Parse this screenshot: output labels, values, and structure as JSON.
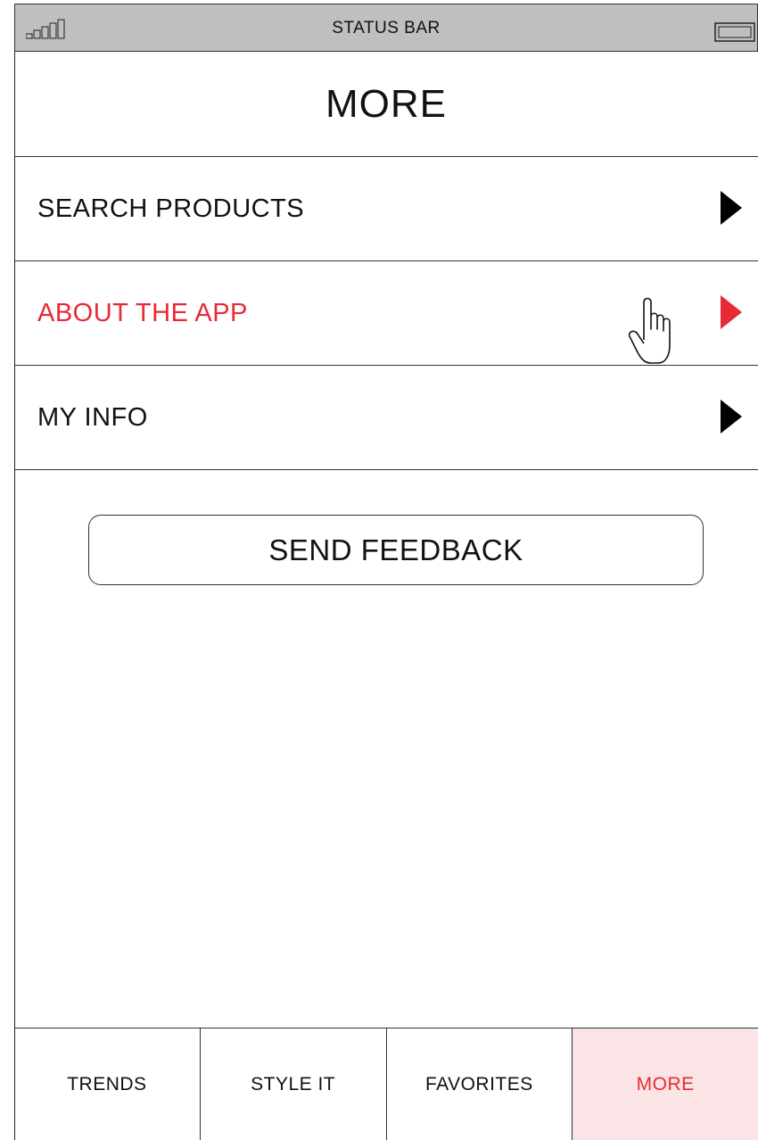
{
  "status_bar": {
    "title": "STATUS BAR",
    "signal_icon": "signal-strength-icon",
    "battery_icon": "battery-icon"
  },
  "header": {
    "title": "MORE"
  },
  "menu": {
    "items": [
      {
        "label": "SEARCH PRODUCTS",
        "icon": "chevron-right-icon",
        "active": false
      },
      {
        "label": "ABOUT THE APP",
        "icon": "chevron-right-icon",
        "active": true
      },
      {
        "label": "MY INFO",
        "icon": "chevron-right-icon",
        "active": false
      }
    ]
  },
  "cursor_icon": "hand-pointer-icon",
  "feedback_button": {
    "label": "SEND FEEDBACK"
  },
  "tab_bar": {
    "tabs": [
      {
        "label": "TRENDS",
        "active": false
      },
      {
        "label": "STYLE IT",
        "active": false
      },
      {
        "label": "FAVORITES",
        "active": false
      },
      {
        "label": "MORE",
        "active": true
      }
    ]
  },
  "colors": {
    "accent": "#e82a35",
    "active_tab_bg": "#fbe4e6",
    "status_bar_bg": "#bfbfbf"
  }
}
